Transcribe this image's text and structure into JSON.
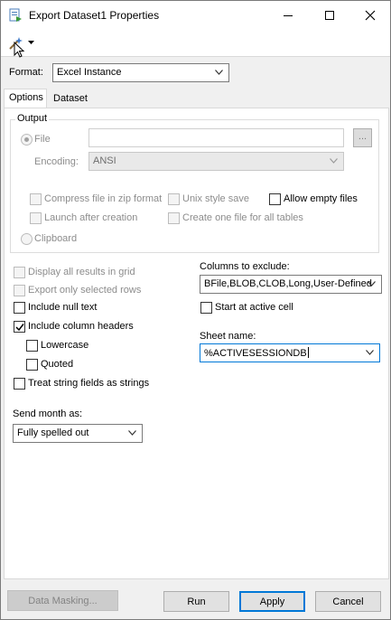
{
  "window": {
    "title": "Export Dataset1 Properties",
    "buttons": {
      "minimize": "minimize-icon",
      "maximize": "maximize-icon",
      "close": "close-icon"
    }
  },
  "format": {
    "label": "Format:",
    "value": "Excel Instance"
  },
  "tabs": [
    {
      "label": "Options",
      "active": true
    },
    {
      "label": "Dataset",
      "active": false
    }
  ],
  "output": {
    "legend": "Output",
    "file_label": "File",
    "file_value": "",
    "file_browse": "...",
    "encoding_label": "Encoding:",
    "encoding_value": "ANSI",
    "compress": "Compress file in zip format",
    "unix_style": "Unix style save",
    "allow_empty": "Allow empty files",
    "launch_after": "Launch after creation",
    "one_file": "Create one file for all tables",
    "clipboard": "Clipboard"
  },
  "options": {
    "display_all": "Display all results in grid",
    "export_selected": "Export only selected rows",
    "include_null": "Include null text",
    "include_headers": "Include column headers",
    "include_headers_checked": true,
    "lowercase": "Lowercase",
    "quoted": "Quoted",
    "treat_strings": "Treat string fields as strings"
  },
  "columns_to_exclude": {
    "label": "Columns to exclude:",
    "value": "BFile,BLOB,CLOB,Long,User-Defined"
  },
  "start_at_active": "Start at active cell",
  "sheet_name": {
    "label": "Sheet name:",
    "value": "%ACTIVESESSIONDB"
  },
  "send_month": {
    "label": "Send month as:",
    "value": "Fully spelled out"
  },
  "footer": {
    "data_masking": "Data Masking...",
    "run": "Run",
    "apply": "Apply",
    "cancel": "Cancel"
  },
  "colors": {
    "accent": "#0078d7",
    "disabled_text": "#8c8c8c",
    "check": "#000000"
  }
}
